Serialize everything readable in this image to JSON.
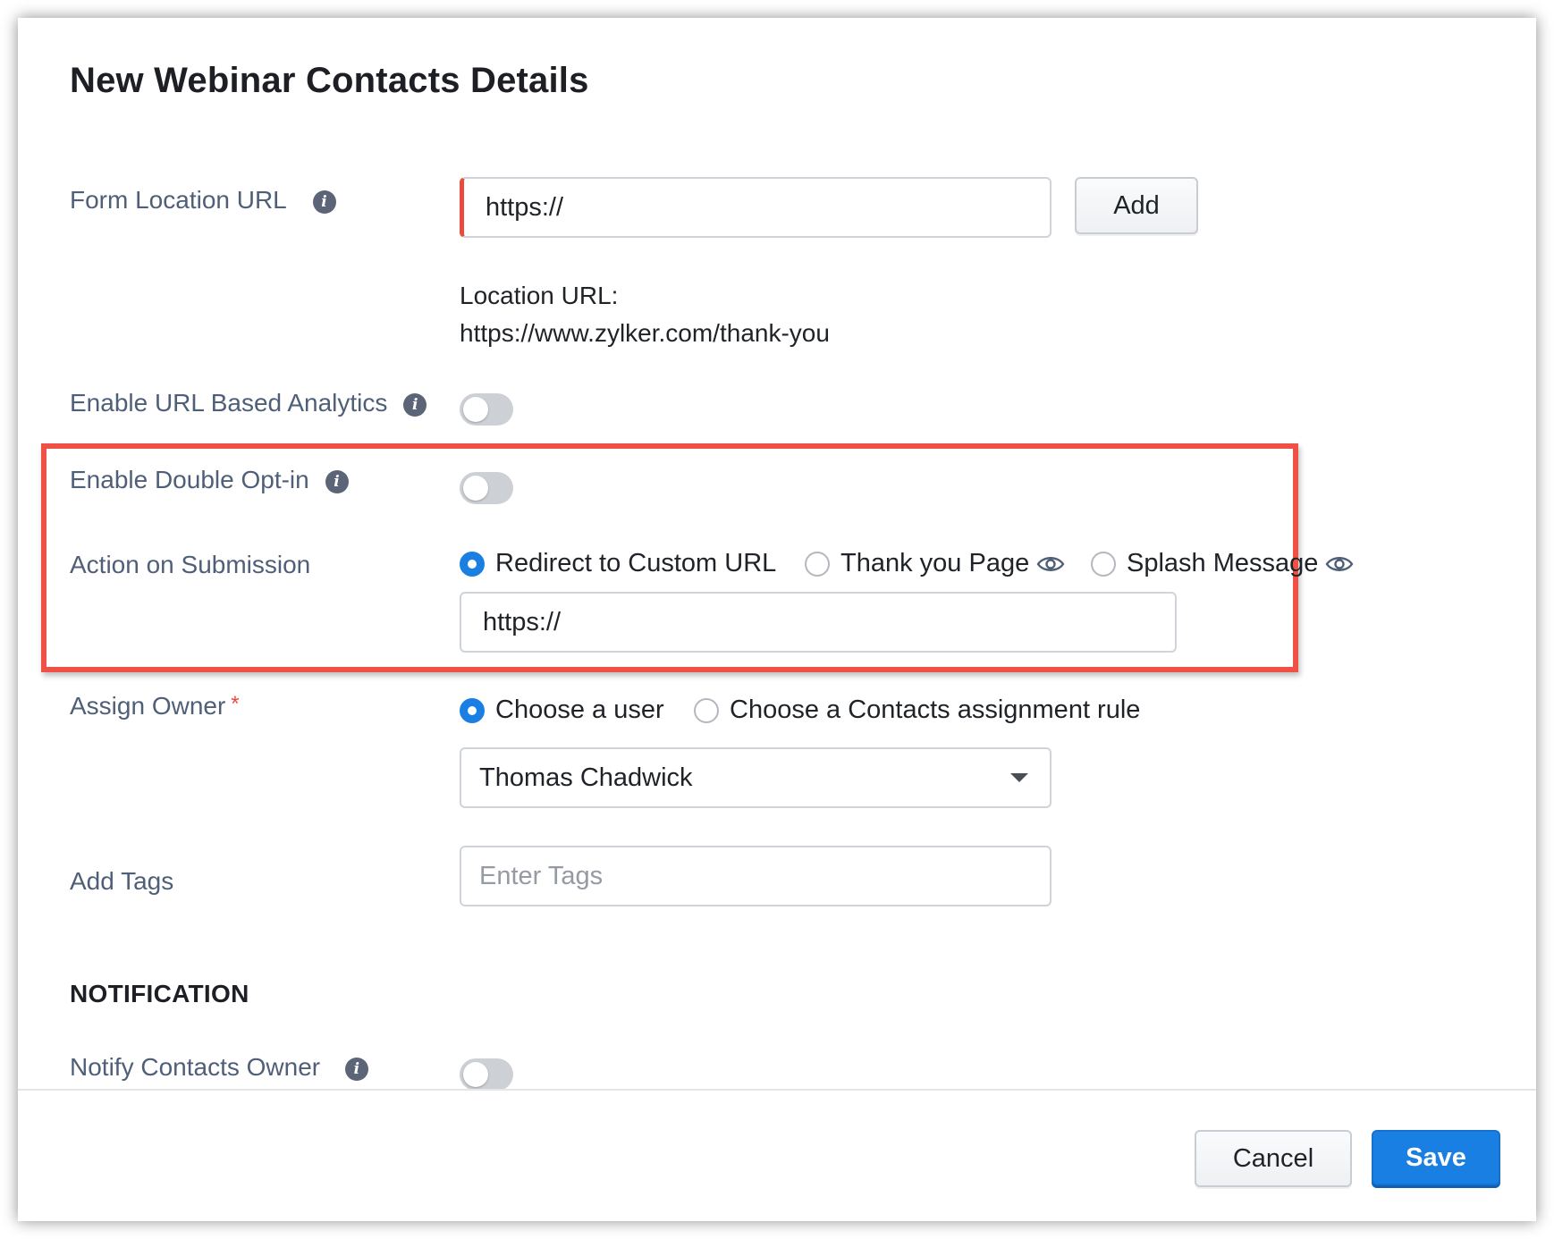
{
  "dialog": {
    "title": "New Webinar Contacts Details"
  },
  "form_location": {
    "label": "Form Location URL",
    "input_value": "https://",
    "add_button": "Add",
    "location_url_label": "Location URL:",
    "location_url_value": "https://www.zylker.com/thank-you"
  },
  "url_analytics": {
    "label": "Enable URL Based Analytics",
    "enabled": false
  },
  "double_opt_in": {
    "label": "Enable Double Opt-in",
    "enabled": false
  },
  "action_on_submission": {
    "label": "Action on Submission",
    "options": [
      {
        "label": "Redirect to Custom URL",
        "selected": true
      },
      {
        "label": "Thank you Page",
        "selected": false
      },
      {
        "label": "Splash Message",
        "selected": false
      }
    ],
    "url_value": "https://"
  },
  "assign_owner": {
    "label": "Assign Owner",
    "required_mark": "*",
    "options": [
      {
        "label": "Choose a user",
        "selected": true
      },
      {
        "label": "Choose a Contacts assignment rule",
        "selected": false
      }
    ],
    "selected_user": "Thomas Chadwick"
  },
  "tags": {
    "label": "Add Tags",
    "placeholder": "Enter Tags"
  },
  "notification": {
    "heading": "NOTIFICATION",
    "notify_owner_label": "Notify Contacts Owner",
    "notify_owner_enabled": false
  },
  "footer": {
    "cancel_label": "Cancel",
    "save_label": "Save"
  },
  "colors": {
    "accent": "#1a7fe3",
    "highlight_border": "#ef5146",
    "error_border": "#e94b3c",
    "label_text": "#4f5f78"
  }
}
